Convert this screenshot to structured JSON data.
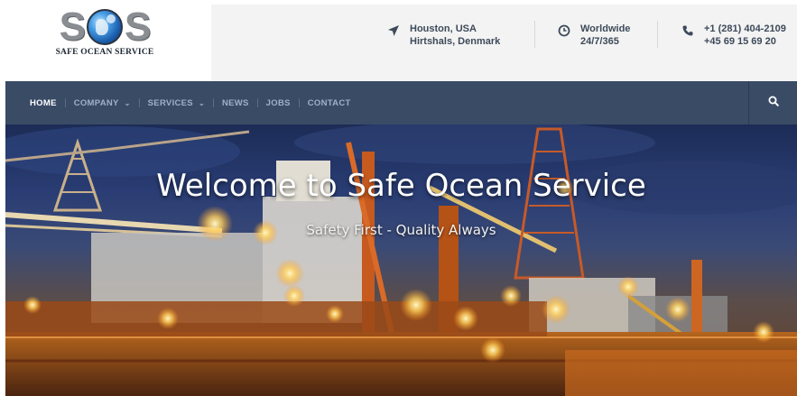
{
  "logo": {
    "letters": [
      "S",
      "S"
    ],
    "text": "SAFE OCEAN SERVICE"
  },
  "contact": {
    "location": {
      "icon": "location-arrow-icon",
      "lines": [
        "Houston, USA",
        "Hirtshals, Denmark"
      ]
    },
    "hours": {
      "icon": "clock-icon",
      "lines": [
        "Worldwide",
        "24/7/365"
      ]
    },
    "phone": {
      "icon": "phone-icon",
      "lines": [
        "+1 (281) 404-2109",
        "+45 69 15 69 20"
      ]
    }
  },
  "nav": {
    "items": [
      {
        "label": "HOME",
        "active": true,
        "dropdown": false
      },
      {
        "label": "COMPANY",
        "active": false,
        "dropdown": true
      },
      {
        "label": "SERVICES",
        "active": false,
        "dropdown": true
      },
      {
        "label": "NEWS",
        "active": false,
        "dropdown": false
      },
      {
        "label": "JOBS",
        "active": false,
        "dropdown": false
      },
      {
        "label": "CONTACT",
        "active": false,
        "dropdown": false
      }
    ],
    "search_icon": "search-icon"
  },
  "hero": {
    "title": "Welcome to Safe Ocean Service",
    "subtitle": "Safety First - Quality Always"
  },
  "colors": {
    "nav_bg": "#3a4b66",
    "info_bg": "#f3f3f3",
    "info_text": "#3d4a5a"
  }
}
